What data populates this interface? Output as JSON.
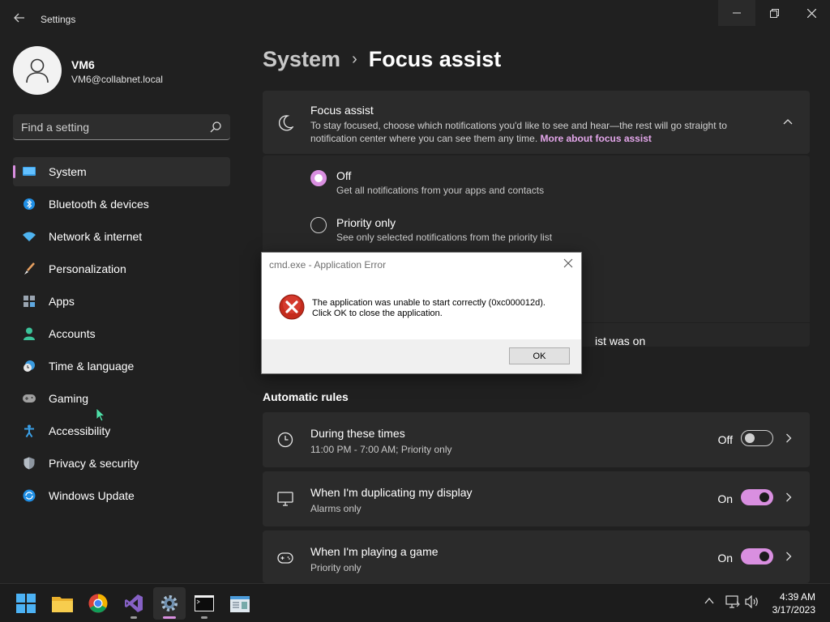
{
  "window": {
    "title": "Settings",
    "back_icon": "back-arrow-icon",
    "minimize_icon": "minimize-icon",
    "maximize_icon": "restore-icon",
    "close_icon": "close-icon"
  },
  "user": {
    "name": "VM6",
    "email": "VM6@collabnet.local"
  },
  "search": {
    "placeholder": "Find a setting"
  },
  "sidebar": {
    "items": [
      {
        "label": "System",
        "icon": "system-icon",
        "active": true
      },
      {
        "label": "Bluetooth & devices",
        "icon": "bluetooth-icon"
      },
      {
        "label": "Network & internet",
        "icon": "wifi-icon"
      },
      {
        "label": "Personalization",
        "icon": "brush-icon"
      },
      {
        "label": "Apps",
        "icon": "apps-icon"
      },
      {
        "label": "Accounts",
        "icon": "account-icon"
      },
      {
        "label": "Time & language",
        "icon": "clock-globe-icon"
      },
      {
        "label": "Gaming",
        "icon": "gamepad-icon"
      },
      {
        "label": "Accessibility",
        "icon": "accessibility-icon"
      },
      {
        "label": "Privacy & security",
        "icon": "shield-icon"
      },
      {
        "label": "Windows Update",
        "icon": "update-icon"
      }
    ]
  },
  "breadcrumb": {
    "parent": "System",
    "separator": "›",
    "current": "Focus assist"
  },
  "focus_assist": {
    "title": "Focus assist",
    "description": "To stay focused, choose which notifications you'd like to see and hear—the rest will go straight to notification center where you can see them any time.",
    "link": "More about focus assist",
    "options": [
      {
        "title": "Off",
        "description": "Get all notifications from your apps and contacts",
        "selected": true
      },
      {
        "title": "Priority only",
        "description": "See only selected notifications from the priority list",
        "selected": false
      }
    ],
    "partial_row_text": "ist was on"
  },
  "automatic_rules": {
    "heading": "Automatic rules",
    "rules": [
      {
        "title": "During these times",
        "subtitle": "11:00 PM - 7:00 AM; Priority only",
        "state": "Off",
        "enabled": false,
        "icon": "clock-icon"
      },
      {
        "title": "When I'm duplicating my display",
        "subtitle": "Alarms only",
        "state": "On",
        "enabled": true,
        "icon": "monitor-icon"
      },
      {
        "title": "When I'm playing a game",
        "subtitle": "Priority only",
        "state": "On",
        "enabled": true,
        "icon": "gamepad-icon"
      }
    ]
  },
  "dialog": {
    "title": "cmd.exe - Application Error",
    "message_line1": "The application was unable to start correctly (0xc000012d).",
    "message_line2": "Click OK to close the application.",
    "ok_label": "OK",
    "icon": "error-icon"
  },
  "taskbar": {
    "apps": [
      "start-icon",
      "file-explorer-icon",
      "chrome-icon",
      "visual-studio-icon",
      "settings-icon",
      "terminal-icon",
      "notepad-icon"
    ],
    "time": "4:39 AM",
    "date": "3/17/2023"
  },
  "colors": {
    "accent": "#d98fe0",
    "background": "#202020",
    "card": "#2b2b2b"
  }
}
